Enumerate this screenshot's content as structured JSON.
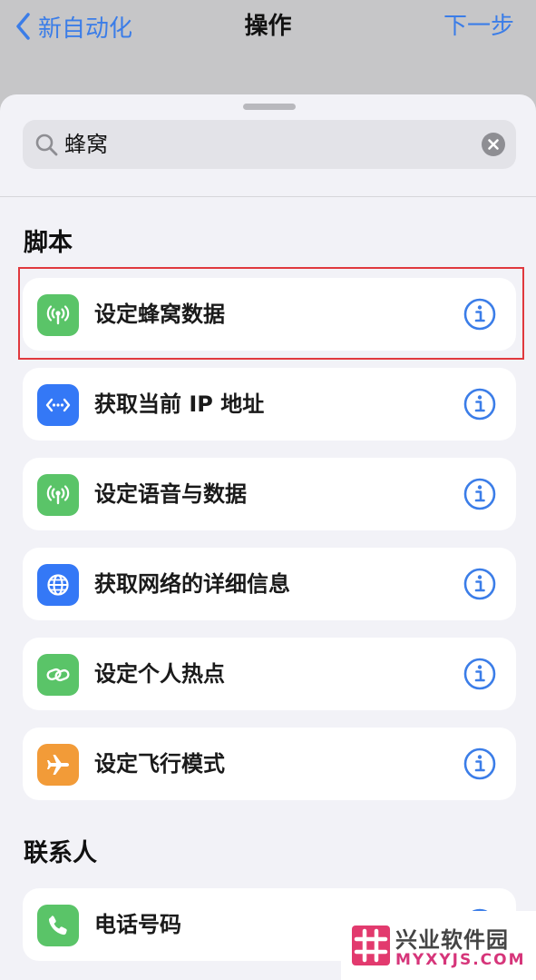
{
  "navbar": {
    "back_label": "新自动化",
    "title": "操作",
    "next_label": "下一步"
  },
  "search": {
    "query": "蜂窝"
  },
  "sections": [
    {
      "header": "脚本",
      "items": [
        {
          "label": "设定蜂窝数据",
          "icon": "cellular-antenna-icon",
          "color": "#5ac468"
        },
        {
          "label": "获取当前 IP 地址",
          "icon": "ip-address-icon",
          "color": "#3478f6"
        },
        {
          "label": "设定语音与数据",
          "icon": "cellular-antenna-icon",
          "color": "#5ac468"
        },
        {
          "label": "获取网络的详细信息",
          "icon": "globe-icon",
          "color": "#3478f6"
        },
        {
          "label": "设定个人热点",
          "icon": "hotspot-link-icon",
          "color": "#5ac468"
        },
        {
          "label": "设定飞行模式",
          "icon": "airplane-icon",
          "color": "#f29b38"
        }
      ]
    },
    {
      "header": "联系人",
      "items": [
        {
          "label": "电话号码",
          "icon": "phone-icon",
          "color": "#5ac468"
        }
      ]
    }
  ],
  "colors": {
    "accent": "#3b7de8",
    "highlight_border": "#e0393e"
  },
  "watermark": {
    "name": "兴业软件园",
    "url": "MYXYJS.COM"
  }
}
